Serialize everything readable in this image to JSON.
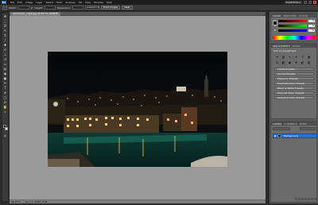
{
  "app": {
    "logo": "Ps"
  },
  "menu": [
    "File",
    "Edit",
    "Image",
    "Layer",
    "Select",
    "Filter",
    "Analysis",
    "3D",
    "View",
    "Window",
    "Help"
  ],
  "workspace": {
    "label": "ESSENTIALS"
  },
  "options": {
    "width_label": "Width:",
    "width_value": "",
    "height_label": "Height:",
    "height_value": "",
    "resolution_label": "Resolution:",
    "resolution_value": "",
    "units_value": "pixels/inch",
    "front_image_button": "Front Image",
    "clear_button": "Clear"
  },
  "document": {
    "tab_title": "stockholm_night.jpg @ 66.7% (RGB/8)"
  },
  "status": {
    "zoom": "66.67%",
    "doc_info": "Doc: 1.37M/1.37M"
  },
  "panels": {
    "color": {
      "tabs": [
        "COLOR",
        "SWATCHES",
        "STYLES"
      ],
      "r": "0",
      "g": "0",
      "b": "0"
    },
    "adjustments": {
      "tabs": [
        "ADJUSTMENTS",
        "MASKS"
      ],
      "title": "Add an adjustment",
      "presets": [
        "Levels Presets",
        "Curves Presets",
        "Exposure Presets",
        "Hue/Saturation Presets",
        "Black & White Presets",
        "Channel Mixer Presets",
        "Selective Color Presets"
      ]
    },
    "layers": {
      "tabs": [
        "LAYERS",
        "CHANNELS",
        "PATHS"
      ],
      "layer_name": "Background"
    }
  },
  "colors": {
    "accent": "#2d6ec8",
    "workspace_bg": "#9a9a9a",
    "panel_bg": "#6b6b6b"
  }
}
